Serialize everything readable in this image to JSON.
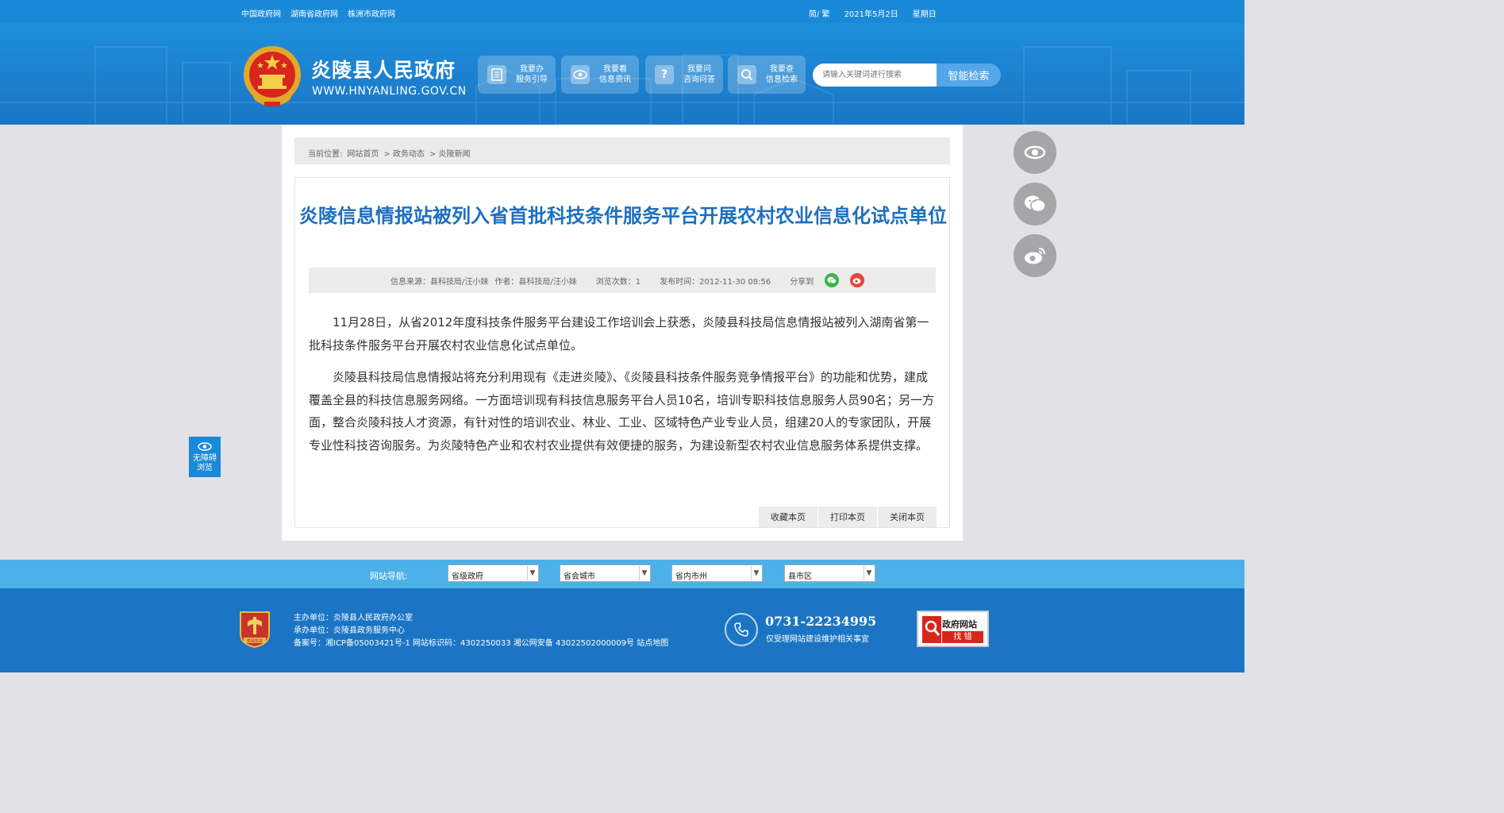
{
  "topbar": {
    "links": [
      "中国政府网",
      "湖南省政府网",
      "株洲市政府网"
    ],
    "lang_toggle": "简/ 繁",
    "date": "2021年5月2日",
    "weekday": "星期日"
  },
  "header": {
    "site_title": "炎陵县人民政府",
    "site_url": "WWW.HNYANLING.GOV.CN",
    "nav": [
      {
        "line1": "我要办",
        "line2": "服务引导",
        "icon": "document-icon"
      },
      {
        "line1": "我要看",
        "line2": "信息资讯",
        "icon": "eye-icon"
      },
      {
        "line1": "我要问",
        "line2": "咨询问答",
        "icon": "question-icon"
      },
      {
        "line1": "我要查",
        "line2": "信息检索",
        "icon": "search-icon"
      }
    ],
    "search_placeholder": "请输入关键词进行搜索",
    "search_button": "智能检索"
  },
  "breadcrumb": {
    "prefix": "当前位置:",
    "items": [
      "网站首页",
      "> 政务动态",
      "> 炎陵新闻"
    ]
  },
  "article": {
    "title": "炎陵信息情报站被列入省首批科技条件服务平台开展农村农业信息化试点单位",
    "source": "信息来源：县科技局/汪小妹",
    "author": "作者：县科技局/汪小妹",
    "views": "浏览次数：1",
    "publish_time": "发布时间：2012-11-30 08:56",
    "share_label": "分享到",
    "paragraphs": [
      "11月28日，从省2012年度科技条件服务平台建设工作培训会上获悉，炎陵县科技局信息情报站被列入湖南省第一批科技条件服务平台开展农村农业信息化试点单位。",
      "炎陵县科技局信息情报站将充分利用现有《走进炎陵》、《炎陵县科技条件服务竞争情报平台》的功能和优势，建成覆盖全县的科技信息服务网络。一方面培训现有科技信息服务平台人员10名，培训专职科技信息服务人员90名；另一方面，整合炎陵科技人才资源，有针对性的培训农业、林业、工业、区域特色产业专业人员，组建20人的专家团队，开展专业性科技咨询服务。为炎陵特色产业和农村农业提供有效便捷的服务，为建设新型农村农业信息服务体系提供支撑。"
    ],
    "actions": [
      "收藏本页",
      "打印本页",
      "关闭本页"
    ]
  },
  "accessibility": {
    "line1": "无障碍",
    "line2": "浏览"
  },
  "footer_nav": {
    "label": "网站导航:",
    "selects": [
      "省级政府",
      "省会城市",
      "省内市州",
      "县市区"
    ]
  },
  "footer": {
    "host": "主办单位：炎陵县人民政府办公室",
    "organizer": "承办单位：炎陵县政务服务中心",
    "record": "备案号：湘ICP备05003421号-1 网站标识码：4302250033 湘公网安备 43022502000009号 站点地图",
    "badge_text": "党政机关",
    "phone": "0731-22234995",
    "phone_desc": "仅受理网站建设维护相关事宜",
    "find_error_line1": "政府网站",
    "find_error_line2": "找 错"
  },
  "colors": {
    "brand_blue": "#1a8ad8",
    "title_blue": "#1d6fc0",
    "footer_blue": "#1b75c4",
    "footnav_blue": "#4bb1e8",
    "wechat_green": "#3bb54a",
    "weibo_red": "#e0473f"
  }
}
